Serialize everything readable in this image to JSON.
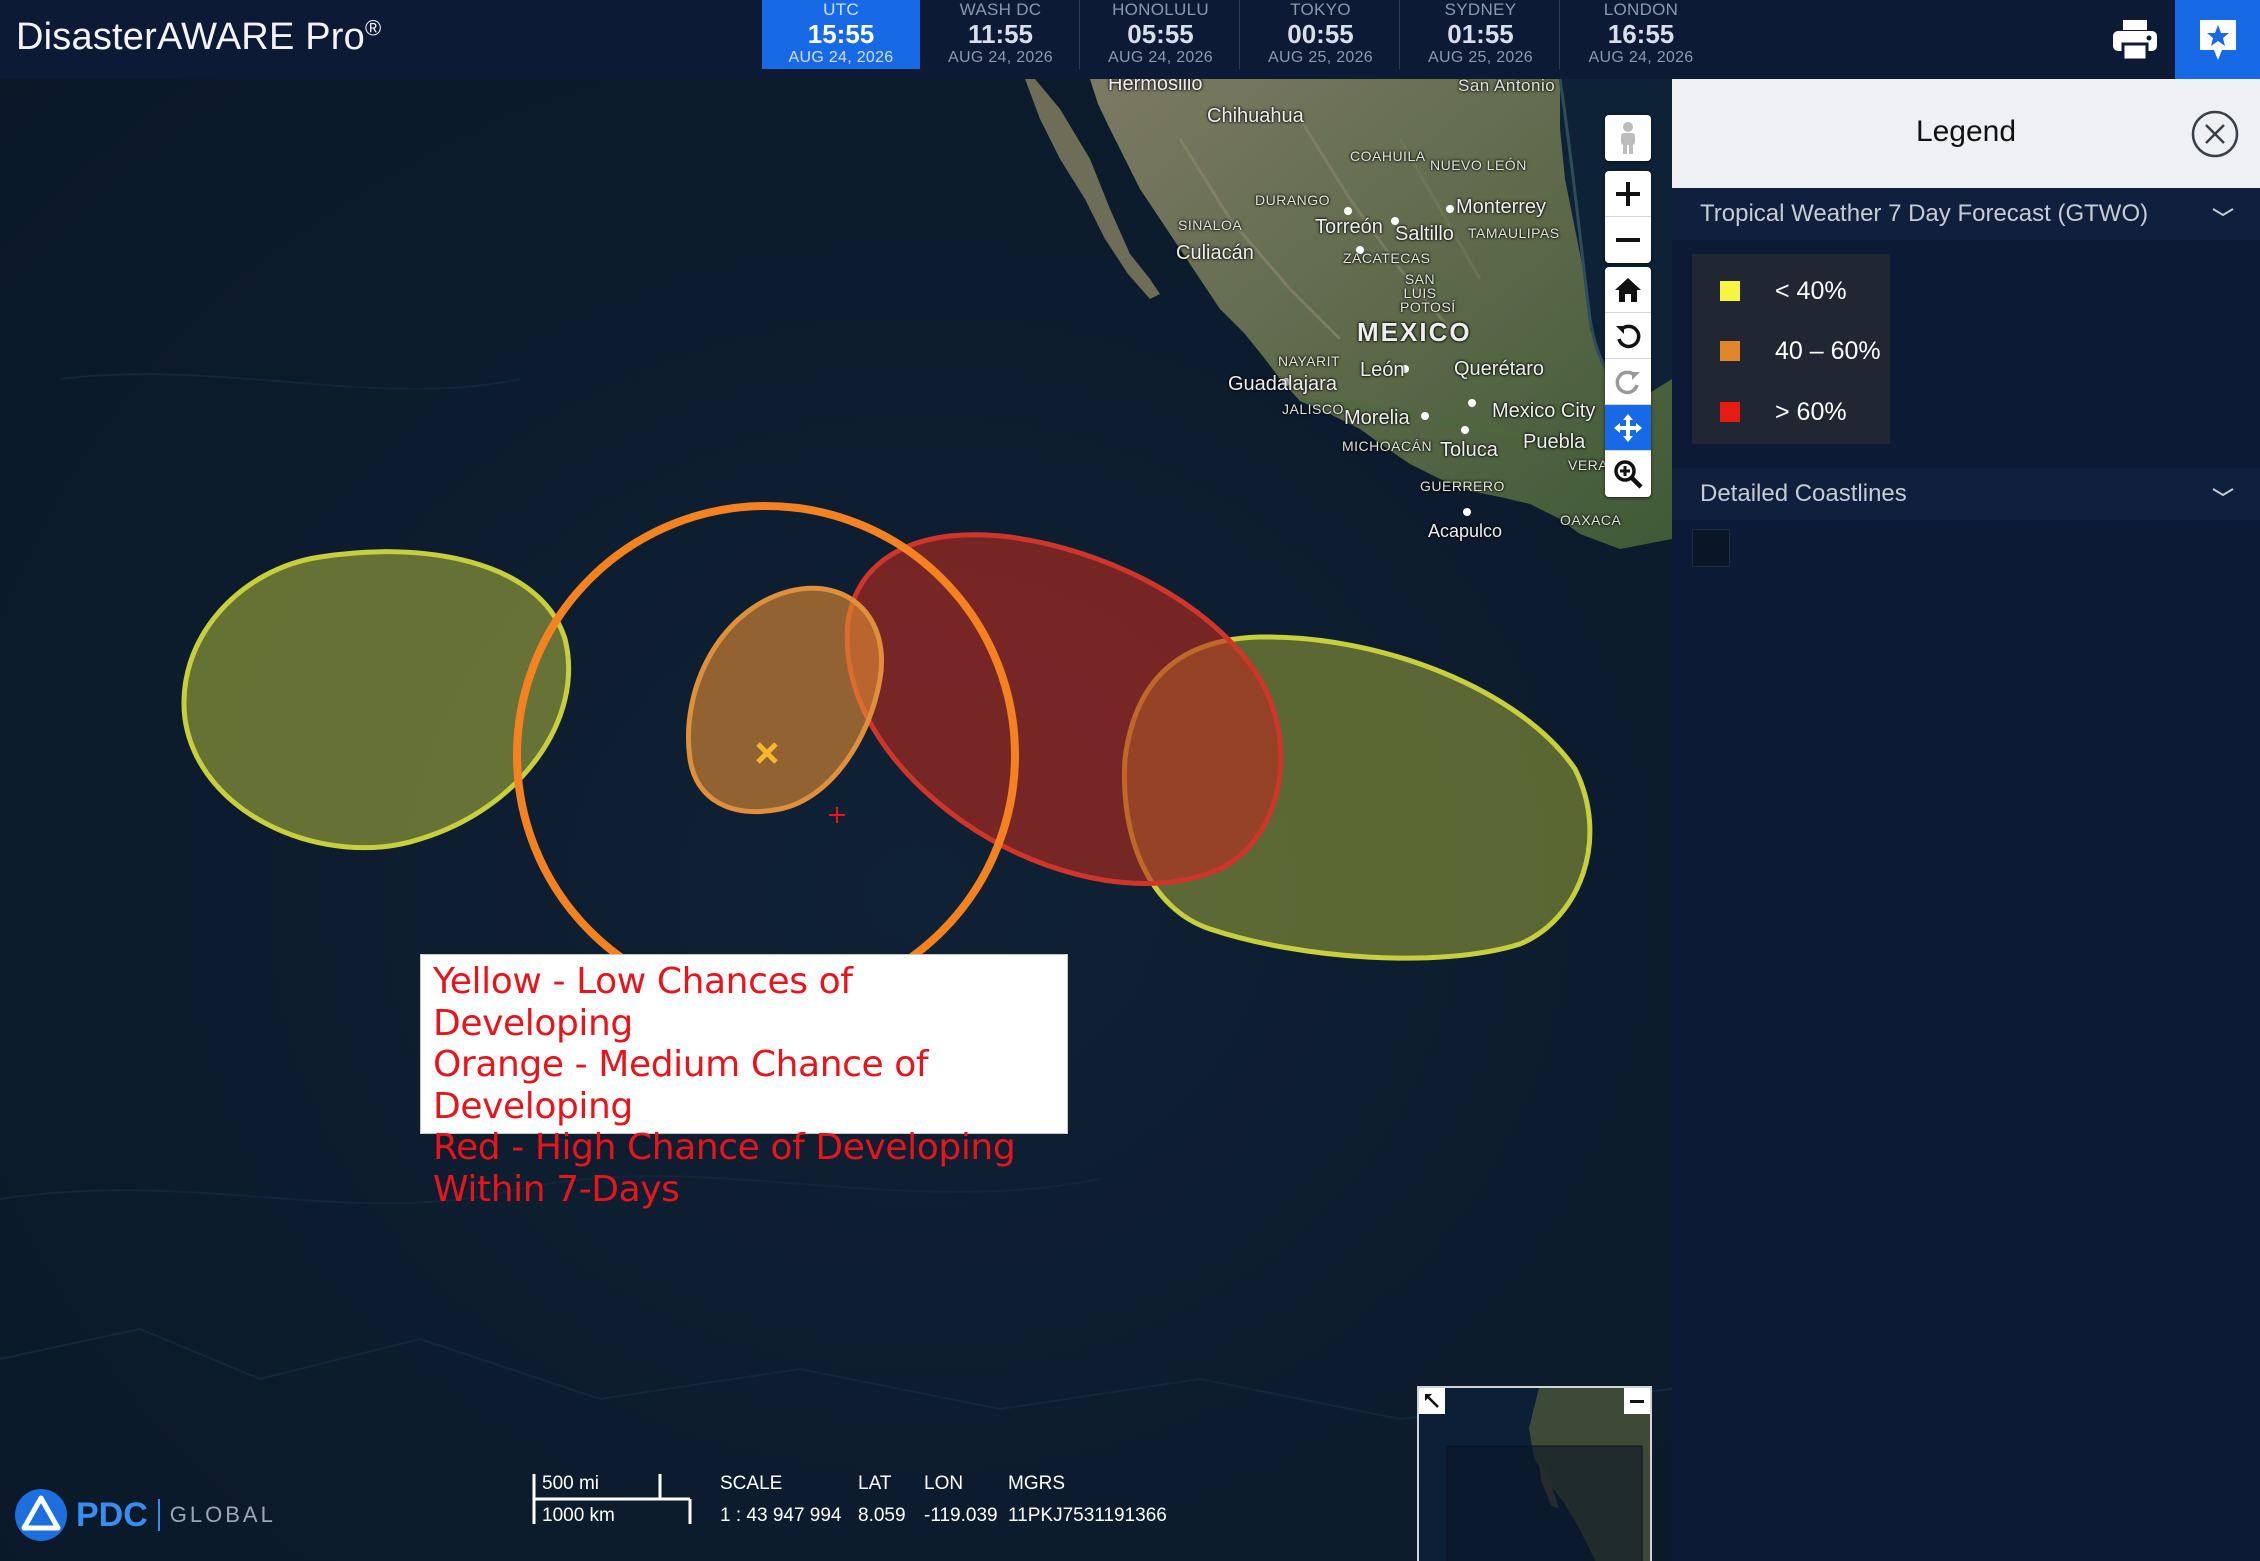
{
  "app": {
    "title": "DisasterAWARE Pro",
    "reg": "®"
  },
  "clocks": [
    {
      "city": "UTC",
      "time": "15:55",
      "date": "AUG 24, 2026",
      "active": true
    },
    {
      "city": "WASH DC",
      "time": "11:55",
      "date": "AUG 24, 2026"
    },
    {
      "city": "HONOLULU",
      "time": "05:55",
      "date": "AUG 24, 2026"
    },
    {
      "city": "TOKYO",
      "time": "00:55",
      "date": "AUG 25, 2026"
    },
    {
      "city": "SYDNEY",
      "time": "01:55",
      "date": "AUG 25, 2026"
    },
    {
      "city": "LONDON",
      "time": "16:55",
      "date": "AUG 24, 2026"
    }
  ],
  "header_icons": {
    "print": "print-icon",
    "bookmark": "star-bookmark-icon"
  },
  "map": {
    "places": {
      "hermosillo": "Hermosillo",
      "chihuahua": "Chihuahua",
      "san_antonio": "San Antonio",
      "coahuila": "COAHUILA",
      "nuevo_leon": "NUEVO LEÓN",
      "durango": "DURANGO",
      "monterrey": "Monterrey",
      "sinaloa": "SINALOA",
      "torreon": "Torreón",
      "saltillo": "Saltillo",
      "tamaulipas": "TAMAULIPAS",
      "culiacan": "Culiacán",
      "zacatecas": "ZACATECAS",
      "san_luis_potosi": "SAN LUIS POTOSÍ",
      "mexico": "MEXICO",
      "nayarit": "NAYARIT",
      "leon": "León",
      "queretaro": "Querétaro",
      "guadalajara": "Guadalajara",
      "jalisco": "JALISCO",
      "morelia": "Morelia",
      "mexico_city": "Mexico City",
      "michoacan": "MICHOACÁN",
      "toluca": "Toluca",
      "puebla": "Puebla",
      "vera": "VERA",
      "guerrero": "GUERRERO",
      "oaxaca": "OAXACA",
      "acapulco": "Acapulco"
    },
    "tools": [
      "pegman-icon",
      "zoom-in-icon",
      "zoom-out-icon",
      "home-icon",
      "rotate-left-icon",
      "rotate-right-icon",
      "pan-move-icon",
      "zoom-box-icon"
    ]
  },
  "annotation": {
    "line1": "Yellow - Low Chances of Developing",
    "line2": "Orange - Medium Chance of Developing",
    "line3": "Red - High Chance of Developing",
    "line4": "Within 7-Days"
  },
  "footer": {
    "logo_text": "PDC",
    "logo_sub": "GLOBAL",
    "scale_mi": "500 mi",
    "scale_km": "1000 km",
    "scale_label": "SCALE",
    "scale_value": "1 : 43 947 994",
    "lat_label": "LAT",
    "lat_value": "8.059",
    "lon_label": "LON",
    "lon_value": "-119.039",
    "mgrs_label": "MGRS",
    "mgrs_value": "11PKJ7531191366"
  },
  "legend": {
    "title": "Legend",
    "section1": "Tropical Weather 7 Day Forecast (GTWO)",
    "items": [
      {
        "label": "< 40%",
        "color": "#f5f542"
      },
      {
        "label": "40 – 60%",
        "color": "#e0872c"
      },
      {
        "label": "> 60%",
        "color": "#e81b12"
      }
    ],
    "section2": "Detailed Coastlines"
  },
  "colors": {
    "accent": "#1769e6",
    "low": "#c8cf3c",
    "medium": "#f58220",
    "high": "#d22a1e"
  }
}
